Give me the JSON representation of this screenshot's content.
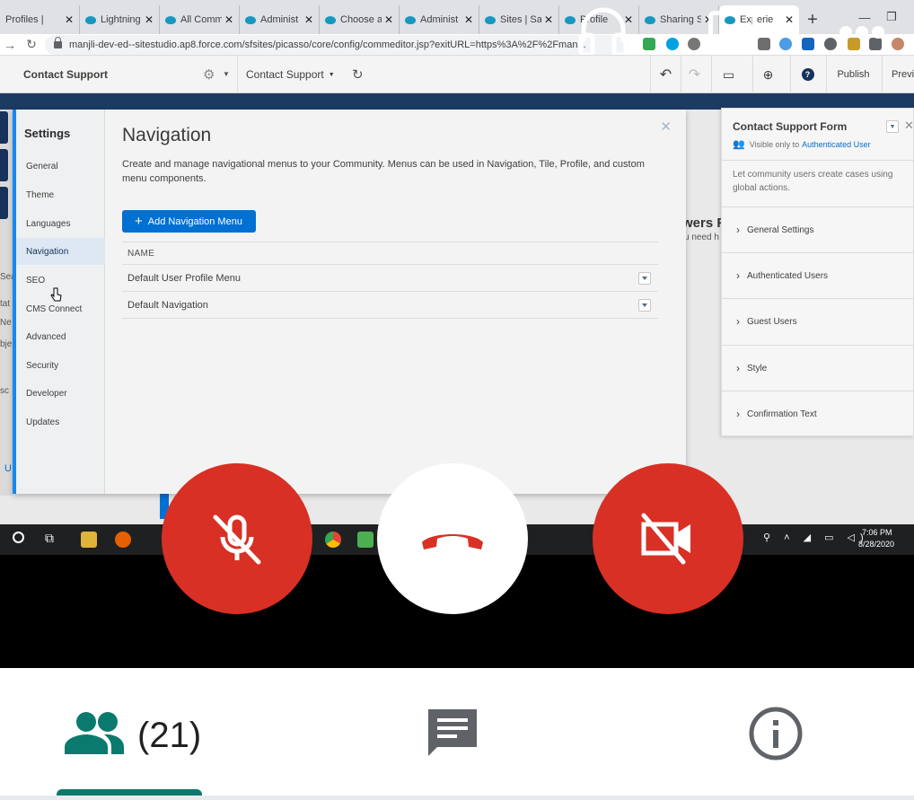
{
  "browser": {
    "tabs": [
      {
        "label": "Profiles |"
      },
      {
        "label": "Lightning"
      },
      {
        "label": "All Comm"
      },
      {
        "label": "Administ"
      },
      {
        "label": "Choose a"
      },
      {
        "label": "Administ"
      },
      {
        "label": "Sites | Sa"
      },
      {
        "label": "Profile"
      },
      {
        "label": "Sharing S"
      },
      {
        "label": "Experie"
      }
    ],
    "close_glyph": "✕",
    "new_tab": "+",
    "url": "manjli-dev-ed--sitestudio.ap8.force.com/sfsites/picasso/core/config/commeditor.jsp?exitURL=https%3A%2F%2Fman..."
  },
  "builder": {
    "page_name": "Contact Support",
    "page_selector": "Contact Support",
    "publish": "Publish",
    "preview": "Previ"
  },
  "settings": {
    "heading": "Settings",
    "items": [
      {
        "label": "General"
      },
      {
        "label": "Theme"
      },
      {
        "label": "Languages"
      },
      {
        "label": "Navigation"
      },
      {
        "label": "SEO"
      },
      {
        "label": "CMS Connect"
      },
      {
        "label": "Advanced"
      },
      {
        "label": "Security"
      },
      {
        "label": "Developer"
      },
      {
        "label": "Updates"
      }
    ],
    "selected_index": 3,
    "title": "Navigation",
    "description": "Create and manage navigational menus to your Community. Menus can be used in Navigation, Tile, Profile, and custom menu components.",
    "add_button": "Add Navigation Menu",
    "column_header": "NAME",
    "rows": [
      {
        "name": "Default User Profile Menu"
      },
      {
        "name": "Default Navigation"
      }
    ]
  },
  "right_panel": {
    "title": "Contact Support Form",
    "visibility_prefix": "Visible only to",
    "visibility_link": "Authenticated User",
    "description": "Let community users create cases using global actions.",
    "sections": [
      {
        "label": "General Settings"
      },
      {
        "label": "Authenticated Users"
      },
      {
        "label": "Guest Users"
      },
      {
        "label": "Style"
      },
      {
        "label": "Confirmation Text"
      }
    ]
  },
  "background_fragments": {
    "heading_frag": "wers F",
    "sub_frag": "u need h",
    "left_frags": [
      "Sea",
      "tat",
      "Ne",
      "bje",
      "sc",
      "U"
    ]
  },
  "taskbar": {
    "time": "7:06 PM",
    "date": "8/28/2020"
  },
  "call": {
    "participant_count": "(21)"
  },
  "colors": {
    "accent_red": "#d93025",
    "teal": "#0b7a6e",
    "salesforce_blue": "#0070d2"
  }
}
